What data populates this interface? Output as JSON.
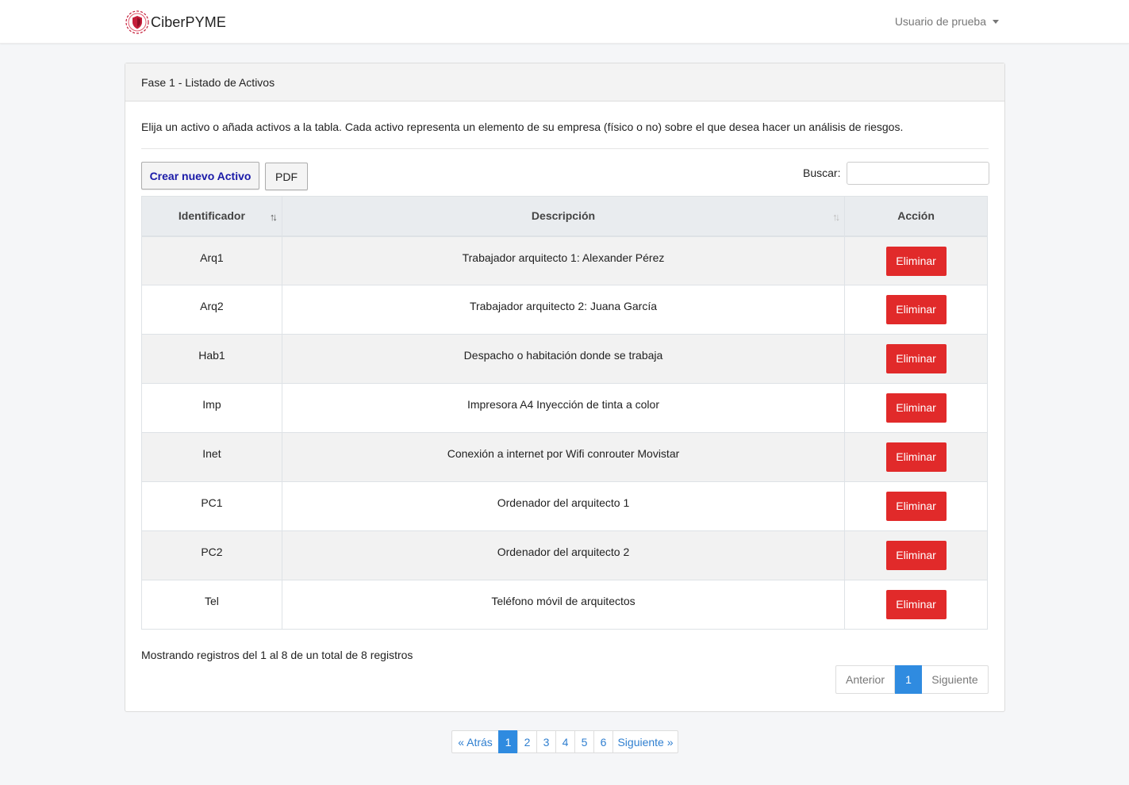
{
  "navbar": {
    "brand_name": "CiberPYME",
    "user_label": "Usuario de prueba"
  },
  "card": {
    "header": "Fase 1 - Listado de Activos",
    "intro": "Elija un activo o añada activos a la tabla. Cada activo representa un elemento de su empresa (físico o no) sobre el que desea hacer un análisis de riesgos."
  },
  "toolbar": {
    "create_label": "Crear nuevo Activo",
    "pdf_label": "PDF",
    "search_label": "Buscar:",
    "search_value": ""
  },
  "table": {
    "headers": [
      "Identificador",
      "Descripción",
      "Acción"
    ],
    "delete_label": "Eliminar",
    "rows": [
      {
        "id": "Arq1",
        "desc": "Trabajador arquitecto 1: Alexander Pérez"
      },
      {
        "id": "Arq2",
        "desc": "Trabajador arquitecto 2: Juana García"
      },
      {
        "id": "Hab1",
        "desc": "Despacho o habitación donde se trabaja"
      },
      {
        "id": "Imp",
        "desc": "Impresora A4 Inyección de tinta a color"
      },
      {
        "id": "Inet",
        "desc": "Conexión a internet por Wifi conrouter Movistar"
      },
      {
        "id": "PC1",
        "desc": "Ordenador del arquitecto 1"
      },
      {
        "id": "PC2",
        "desc": "Ordenador del arquitecto 2"
      },
      {
        "id": "Tel",
        "desc": "Teléfono móvil de arquitectos"
      }
    ]
  },
  "info": "Mostrando registros del 1 al 8 de un total de 8 registros",
  "table_pager": {
    "prev": "Anterior",
    "current": "1",
    "next": "Siguiente"
  },
  "pagination": {
    "prev": "« Atrás",
    "pages": [
      "1",
      "2",
      "3",
      "4",
      "5",
      "6"
    ],
    "active": "1",
    "next": "Siguiente »"
  },
  "colors": {
    "delete": "#e12a2a",
    "active_page": "#2f8be0",
    "link": "#2f7fd0",
    "brand_logo": "#c41e3a"
  }
}
